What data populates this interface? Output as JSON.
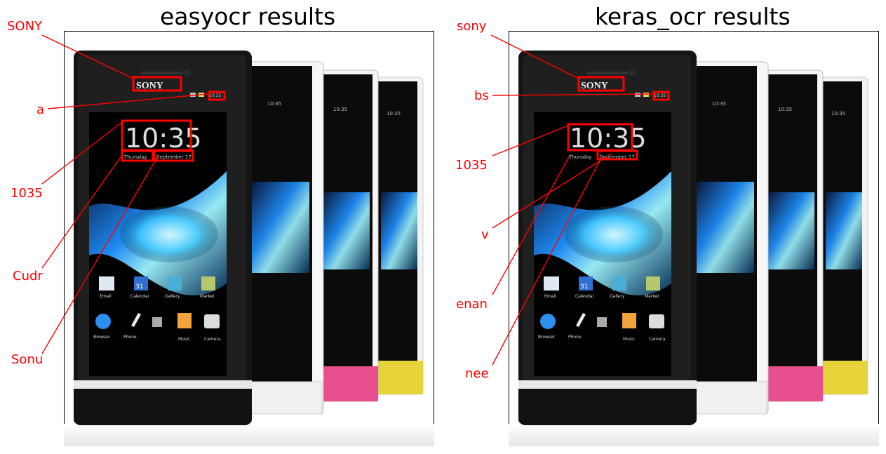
{
  "left": {
    "title": "easyocr results",
    "labels": [
      "SONY",
      "a",
      "1035",
      "Cudr",
      "Sonu"
    ]
  },
  "right": {
    "title": "keras_ocr results",
    "labels": [
      "sony",
      "bs",
      "1035",
      "v",
      "enan",
      "nee"
    ]
  },
  "phone": {
    "brand": "SONY",
    "clock": "10:35",
    "day": "Thursday",
    "date": "September 17",
    "small_time": "10:35",
    "apps_row1": [
      "Email",
      "Calendar",
      "Gallery",
      "Market"
    ],
    "apps_row2": [
      "Browser",
      "Phone",
      "",
      "Music",
      "Camera"
    ],
    "calendar_num": "31"
  },
  "colors": {
    "annotation": "#ff0000"
  }
}
